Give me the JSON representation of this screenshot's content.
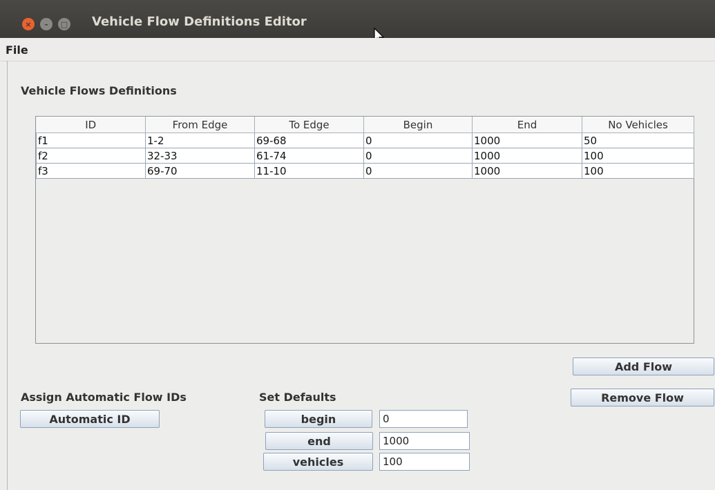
{
  "window": {
    "title": "Vehicle Flow Definitions Editor"
  },
  "menu": {
    "file": "File"
  },
  "flows": {
    "heading": "Vehicle Flows Definitions",
    "columns": [
      "ID",
      "From Edge",
      "To Edge",
      "Begin",
      "End",
      "No Vehicles"
    ],
    "rows": [
      [
        "f1",
        "1-2",
        "69-68",
        "0",
        "1000",
        "50"
      ],
      [
        "f2",
        "32-33",
        "61-74",
        "0",
        "1000",
        "100"
      ],
      [
        "f3",
        "69-70",
        "11-10",
        "0",
        "1000",
        "100"
      ]
    ]
  },
  "actions": {
    "add_flow": "Add Flow",
    "remove_flow": "Remove Flow"
  },
  "auto_ids": {
    "heading": "Assign Automatic Flow IDs",
    "button": "Automatic ID"
  },
  "defaults": {
    "heading": "Set Defaults",
    "begin_label": "begin",
    "begin_value": "0",
    "end_label": "end",
    "end_value": "1000",
    "vehicles_label": "vehicles",
    "vehicles_value": "100"
  }
}
